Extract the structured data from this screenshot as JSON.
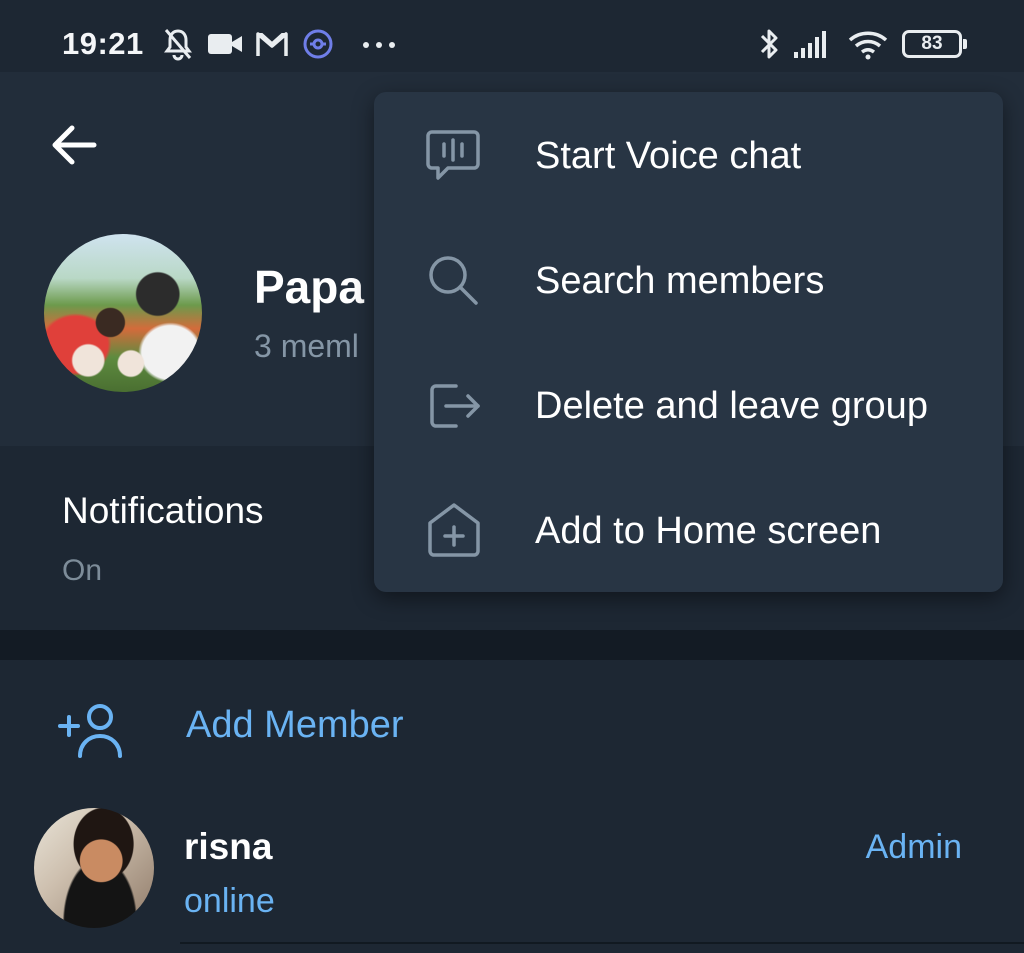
{
  "status_bar": {
    "time": "19:21",
    "icons": [
      "bell-off-icon",
      "video-camera-icon",
      "gmail-icon",
      "vpn-app-icon",
      "more-dots-icon",
      "bluetooth-icon",
      "signal-icon",
      "wifi-icon"
    ],
    "battery": "83"
  },
  "header": {
    "back_icon": "arrow-left-icon",
    "group_name": "Papa",
    "group_subtitle": "3 meml"
  },
  "notifications": {
    "title": "Notifications",
    "value": "On"
  },
  "members": {
    "add_member_label": "Add Member",
    "list": [
      {
        "name": "risna",
        "status": "online",
        "role": "Admin"
      }
    ]
  },
  "menu": {
    "items": [
      {
        "label": "Start Voice chat",
        "icon": "voice-chat-icon"
      },
      {
        "label": "Search members",
        "icon": "search-icon"
      },
      {
        "label": "Delete and leave group",
        "icon": "leave-icon"
      },
      {
        "label": "Add to Home screen",
        "icon": "add-home-icon"
      }
    ]
  },
  "colors": {
    "background": "#1d2733",
    "header": "#222d3a",
    "menu": "#283544",
    "accent": "#6ab3f3",
    "secondary_text": "#8596a6"
  }
}
